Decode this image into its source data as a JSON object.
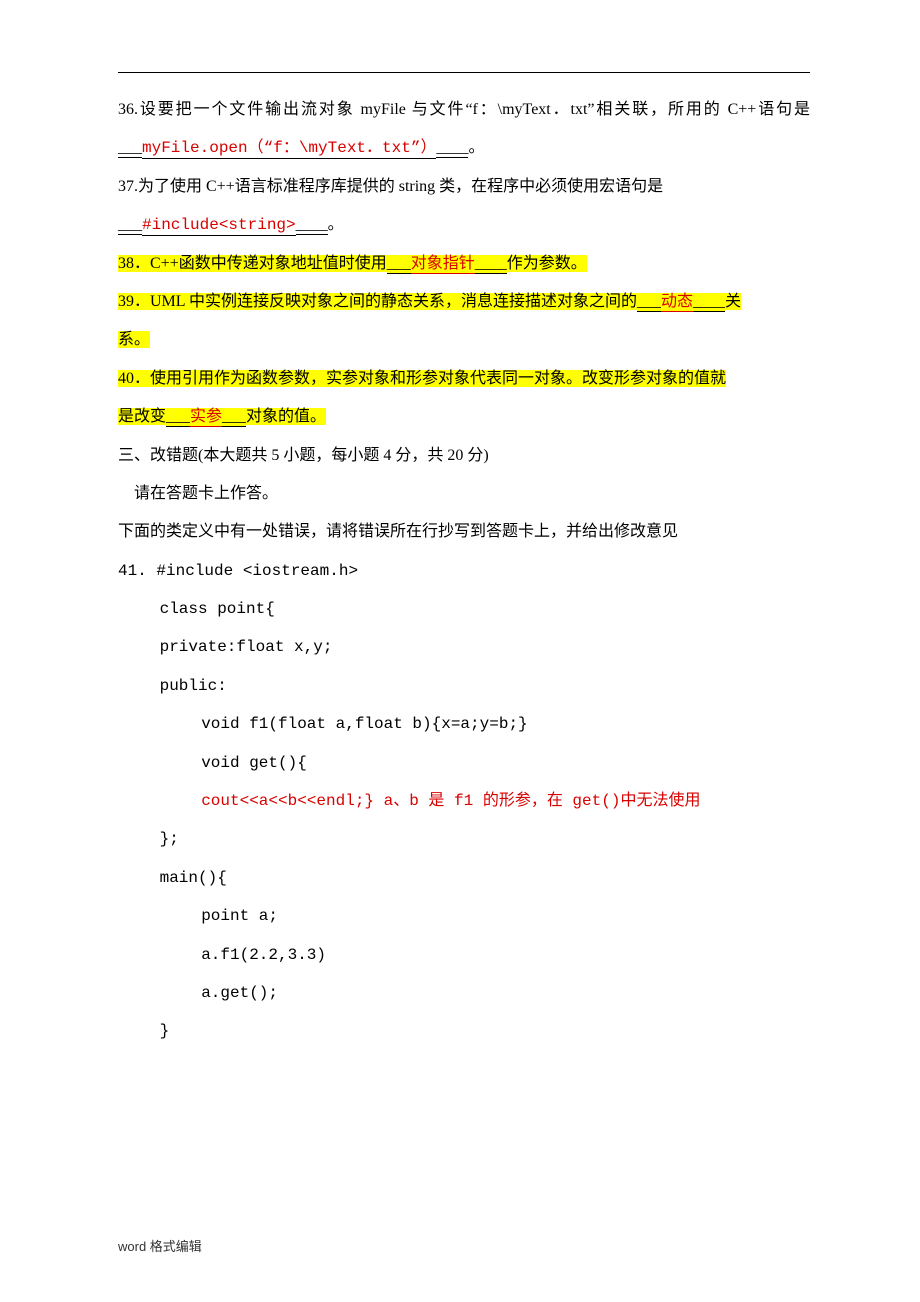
{
  "header": {
    "dots": [
      "·",
      "·",
      "·",
      "·"
    ]
  },
  "q36": {
    "pre": "36.设要把一个文件输出流对象 myFile 与文件“f：\\myText．txt”相关联，所用的 C++语句是",
    "blank_pre": "___",
    "ans": "myFile.open（“f：\\myText．txt”）",
    "blank_post": "____",
    "post": "。"
  },
  "q37": {
    "pre": "37.为了使用 C++语言标准程序库提供的 string 类，在程序中必须使用宏语句是",
    "blank_pre_a": "___",
    "ans": "#include<string>",
    "blank_post_a": "____",
    "post": "。"
  },
  "q38": {
    "pre": "38．C++函数中传递对象地址值时使用",
    "ans": "对象指针",
    "post": "作为参数。"
  },
  "q39": {
    "pre": "39．UML 中实例连接反映对象之间的静态关系，消息连接描述对象之间的",
    "ans": "动态",
    "post1": "关",
    "post2": "系。"
  },
  "q40": {
    "line1_pre": "40．使用引用作为函数参数，实参对象和形参对象代表同一对象。改变形参对象的值就",
    "line2_pre": "是改变",
    "ans": "实参",
    "line2_post": "对象的值。"
  },
  "s3": {
    "title": "三、改错题(本大题共 5 小题，每小题 4 分，共 20 分)",
    "note": "　请在答题卡上作答。",
    "desc": "下面的类定义中有一处错误，请将错误所在行抄写到答题卡上，并给出修改意见"
  },
  "q41": {
    "l1": "41.  #include <iostream.h>",
    "l2": "class point{",
    "l3": "private:float x,y;",
    "l4": "public:",
    "l5": "void f1(float a,float b){x=a;y=b;}",
    "l6": "void get(){",
    "l7": "cout<<a<<b<<endl;}   a、b 是 f1 的形参，在 get()中无法使用",
    "l8": "};",
    "l9": "main(){",
    "l10": "point a;",
    "l11": "a.f1(2.2,3.3)",
    "l12": "a.get();",
    "l13": "}"
  },
  "footer": "word 格式编辑"
}
